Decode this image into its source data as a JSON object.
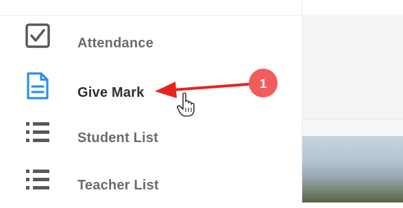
{
  "sidebar": {
    "items": [
      {
        "label": "Attendance",
        "icon": "checkbox-icon"
      },
      {
        "label": "Give Mark",
        "icon": "document-icon",
        "active": true
      },
      {
        "label": "Student List",
        "icon": "list-icon"
      },
      {
        "label": "Teacher List",
        "icon": "list-icon"
      }
    ]
  },
  "annotation": {
    "step_number": "1",
    "badge_color": "#f25c5c",
    "arrow_color": "#e8231f"
  },
  "colors": {
    "document_icon_blue": "#2f8fe8",
    "icon_gray": "#595959"
  }
}
